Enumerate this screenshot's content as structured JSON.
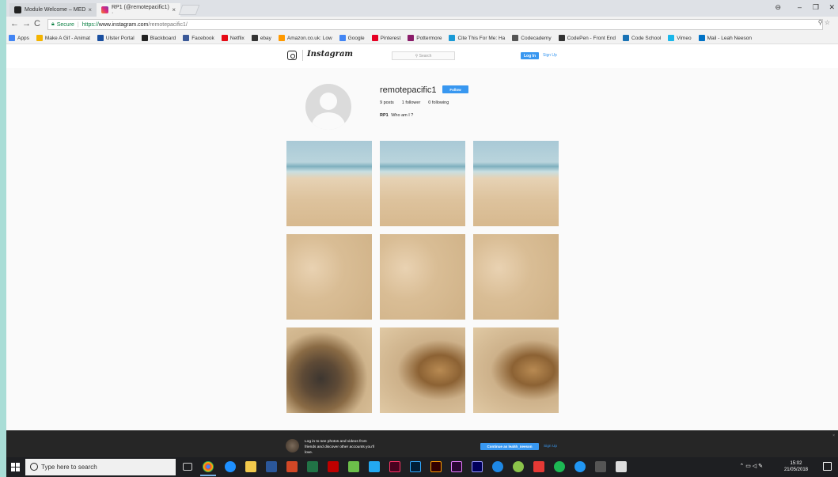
{
  "browser": {
    "tabs": [
      {
        "title": "Module Welcome – MED",
        "active": false
      },
      {
        "title": "RP1 (@remotepacific1) ·",
        "active": true
      }
    ],
    "url": {
      "secure_label": "Secure",
      "scheme": "https://",
      "host": "www.instagram.com",
      "path": "/remotepacific1/"
    },
    "bookmarks": [
      {
        "label": "Apps",
        "color": "#4285f4"
      },
      {
        "label": "Make A Gif - Animat",
        "color": "#f4b400"
      },
      {
        "label": "Ulster Portal",
        "color": "#1a4fa0"
      },
      {
        "label": "Blackboard",
        "color": "#222222"
      },
      {
        "label": "Facebook",
        "color": "#3b5998"
      },
      {
        "label": "Netflix",
        "color": "#e50914"
      },
      {
        "label": "ebay",
        "color": "#333333"
      },
      {
        "label": "Amazon.co.uk: Low",
        "color": "#ff9900"
      },
      {
        "label": "Google",
        "color": "#4285f4"
      },
      {
        "label": "Pinterest",
        "color": "#e60023"
      },
      {
        "label": "Pottermore",
        "color": "#8b1c6a"
      },
      {
        "label": "Cite This For Me: Ha",
        "color": "#1a9ad6"
      },
      {
        "label": "Codecademy",
        "color": "#555555"
      },
      {
        "label": "CodePen - Front End",
        "color": "#333333"
      },
      {
        "label": "Code School",
        "color": "#1a73b5"
      },
      {
        "label": "Vimeo",
        "color": "#1ab7ea"
      },
      {
        "label": "Mail - Leah Neeson",
        "color": "#0072c6"
      }
    ]
  },
  "instagram": {
    "logo": "Instagram",
    "search_placeholder": "Search",
    "login_label": "Log In",
    "signup_label": "Sign Up",
    "profile": {
      "username": "remotepacific1",
      "follow_label": "Follow",
      "posts": "9 posts",
      "followers": "1 follower",
      "following": "0 following",
      "bio_name": "RP1",
      "bio_text": "Who am I ?"
    },
    "banner": {
      "text": "Log in to see photos and videos from friends and discover other accounts you'll love.",
      "continue_label": "Continue as leahh_neeson",
      "signup_label": "Sign Up"
    }
  },
  "taskbar": {
    "search_placeholder": "Type here to search",
    "time": "15:02",
    "date": "21/05/2018"
  }
}
